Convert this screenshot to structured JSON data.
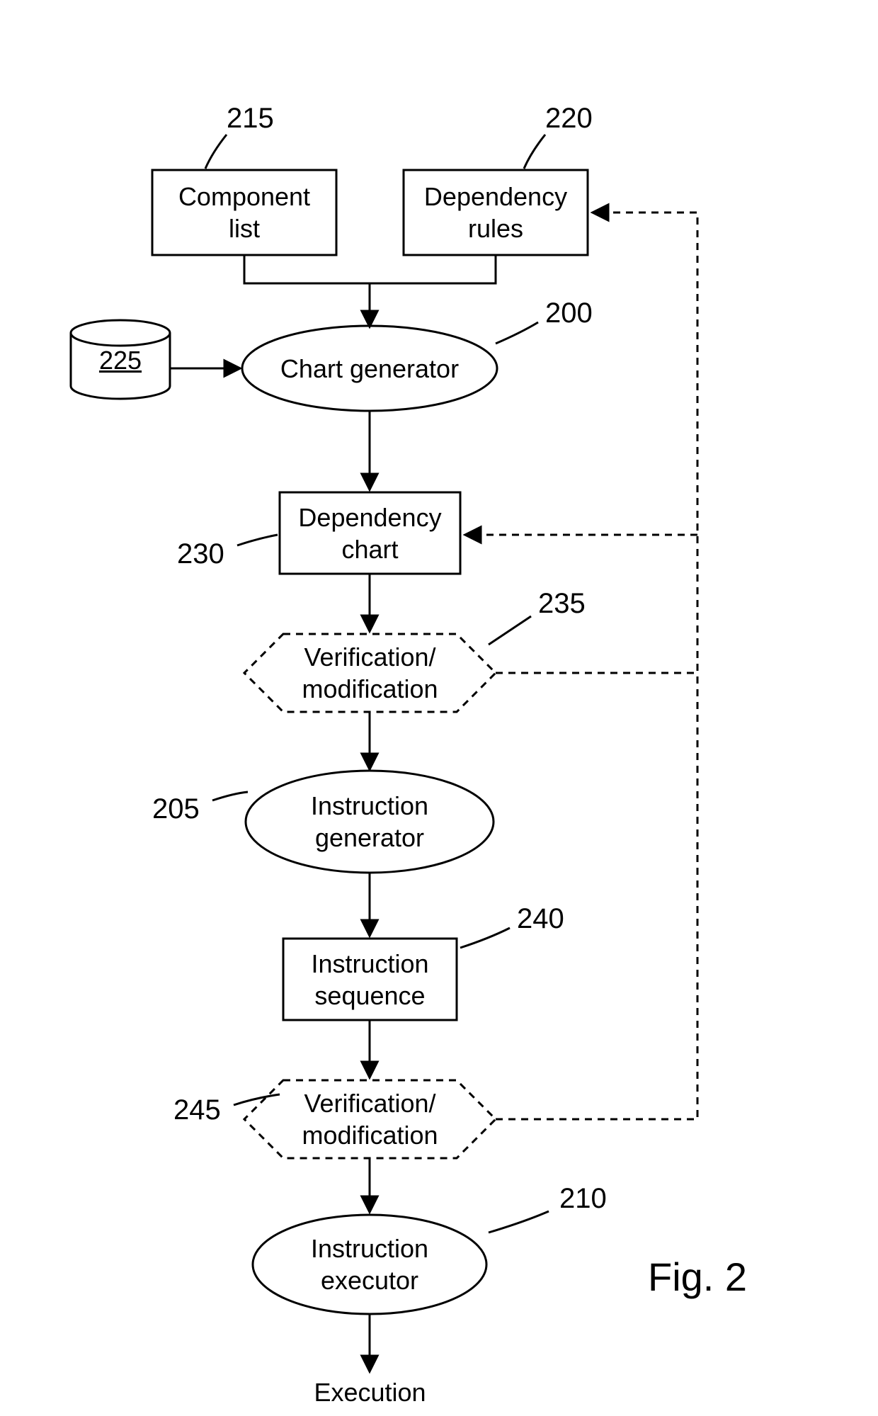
{
  "nodes": {
    "component_list": "Component\nlist",
    "dependency_rules": "Dependency\nrules",
    "chart_generator": "Chart generator",
    "db": "225",
    "dependency_chart": "Dependency\nchart",
    "verify1": "Verification/\nmodification",
    "instruction_generator": "Instruction\ngenerator",
    "instruction_sequence": "Instruction\nsequence",
    "verify2": "Verification/\nmodification",
    "instruction_executor": "Instruction\nexecutor",
    "execution": "Execution"
  },
  "refs": {
    "r215": "215",
    "r220": "220",
    "r200": "200",
    "r225": "225",
    "r230": "230",
    "r235": "235",
    "r205": "205",
    "r240": "240",
    "r245": "245",
    "r210": "210"
  },
  "figure": "Fig. 2"
}
